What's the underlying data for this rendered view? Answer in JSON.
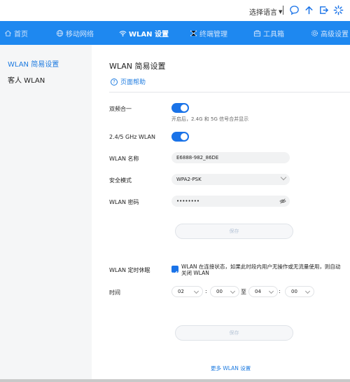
{
  "topbar": {
    "language_label": "选择语言",
    "icons": [
      "chat-icon",
      "upload-icon",
      "logout-icon",
      "loading-icon"
    ]
  },
  "nav": {
    "items": [
      {
        "label": "首页",
        "icon": "home-icon"
      },
      {
        "label": "移动网络",
        "icon": "globe-icon"
      },
      {
        "label": "WLAN 设置",
        "icon": "wifi-icon",
        "active": true
      },
      {
        "label": "终端管理",
        "icon": "devices-icon"
      },
      {
        "label": "工具箱",
        "icon": "toolbox-icon"
      },
      {
        "label": "高级设置",
        "icon": "gear-icon"
      }
    ],
    "accent": "#1e88f0"
  },
  "sidebar": {
    "items": [
      {
        "label": "WLAN 简易设置",
        "active": true
      },
      {
        "label": "客人 WLAN"
      }
    ]
  },
  "main": {
    "title": "WLAN 简易设置",
    "help_label": "页面帮助",
    "dual_band": {
      "label": "双频合一",
      "on": true,
      "hint": "开启后，2.4G 和 5G 信号合并显示"
    },
    "band_24_5": {
      "label": "2.4/5 GHz WLAN",
      "on": true
    },
    "ssid": {
      "label": "WLAN 名称",
      "value": "E6888-982_86DE"
    },
    "security": {
      "label": "安全模式",
      "value": "WPA2-PSK"
    },
    "password": {
      "label": "WLAN 密码",
      "value": "••••••••"
    },
    "save_label": "保存",
    "sleep": {
      "label": "WLAN 定时休眠",
      "checked": true,
      "text": "WLAN 在连接状态，如果此时段内用户无操作或无流量使用，则自动关闭 WLAN"
    },
    "time": {
      "label": "时间",
      "start_hour": "02",
      "start_min": "00",
      "to": "至",
      "end_hour": "04",
      "end_min": "00",
      "colon": ":"
    },
    "save2_label": "保存",
    "more_label": "更多 WLAN 设置"
  }
}
